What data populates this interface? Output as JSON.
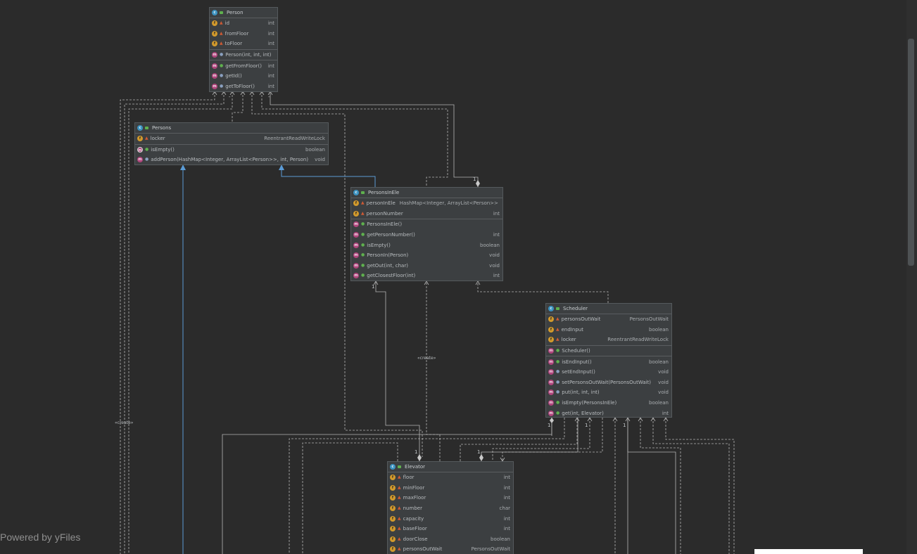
{
  "diagram": {
    "classes": {
      "person": {
        "name": "Person",
        "fields": [
          {
            "name": "id",
            "type": "int"
          },
          {
            "name": "fromFloor",
            "type": "int"
          },
          {
            "name": "toFloor",
            "type": "int"
          }
        ],
        "constructors": [
          {
            "name": "Person(int, int, int)",
            "type": ""
          }
        ],
        "methods": [
          {
            "name": "getFromFloor()",
            "type": "int"
          },
          {
            "name": "getId()",
            "type": "int"
          },
          {
            "name": "getToFloor()",
            "type": "int"
          }
        ]
      },
      "persons": {
        "name": "Persons",
        "fields": [
          {
            "name": "locker",
            "type": "ReentrantReadWriteLock"
          }
        ],
        "methods": [
          {
            "name": "isEmpty()",
            "type": "boolean"
          },
          {
            "name": "addPerson(HashMap<Integer, ArrayList<Person>>, int, Person)",
            "type": "void"
          }
        ]
      },
      "personsInEle": {
        "name": "PersonsInEle",
        "fields": [
          {
            "name": "personInEle",
            "type": "HashMap<Integer, ArrayList<Person>>"
          },
          {
            "name": "personNumber",
            "type": "int"
          }
        ],
        "methods": [
          {
            "name": "PersonsInEle()",
            "type": ""
          },
          {
            "name": "getPersonNumber()",
            "type": "int"
          },
          {
            "name": "isEmpty()",
            "type": "boolean"
          },
          {
            "name": "PersonIn(Person)",
            "type": "void"
          },
          {
            "name": "getOut(int, char)",
            "type": "void"
          },
          {
            "name": "getClosestFloor(int)",
            "type": "int"
          }
        ]
      },
      "scheduler": {
        "name": "Scheduler",
        "fields": [
          {
            "name": "personsOutWait",
            "type": "PersonsOutWait"
          },
          {
            "name": "endInput",
            "type": "boolean"
          },
          {
            "name": "locker",
            "type": "ReentrantReadWriteLock"
          }
        ],
        "constructors": [
          {
            "name": "Scheduler()",
            "type": ""
          }
        ],
        "methods": [
          {
            "name": "isEndInput()",
            "type": "boolean"
          },
          {
            "name": "setEndInput()",
            "type": "void"
          },
          {
            "name": "setPersonsOutWait(PersonsOutWait)",
            "type": "void"
          },
          {
            "name": "put(int, int, int)",
            "type": "void"
          },
          {
            "name": "isEmpty(PersonsInEle)",
            "type": "boolean"
          },
          {
            "name": "get(int, Elevator)",
            "type": "int"
          }
        ]
      },
      "elevator": {
        "name": "Elevator",
        "fields": [
          {
            "name": "floor",
            "type": "int"
          },
          {
            "name": "minFloor",
            "type": "int"
          },
          {
            "name": "maxFloor",
            "type": "int"
          },
          {
            "name": "number",
            "type": "char"
          },
          {
            "name": "capacity",
            "type": "int"
          },
          {
            "name": "baseFloor",
            "type": "int"
          },
          {
            "name": "doorClose",
            "type": "boolean"
          },
          {
            "name": "personsOutWait",
            "type": "PersonsOutWait"
          }
        ]
      }
    },
    "labels": {
      "create_left": "«create»",
      "create_mid": "«create»",
      "mult_1": "1",
      "minus": "-"
    },
    "colors": {
      "background": "#2b2b2b",
      "node": "#3c3f41",
      "edge": "#b5b5b5",
      "inheritance": "#5b9bd5"
    }
  },
  "footer": {
    "powered": "Powered by yFiles"
  }
}
